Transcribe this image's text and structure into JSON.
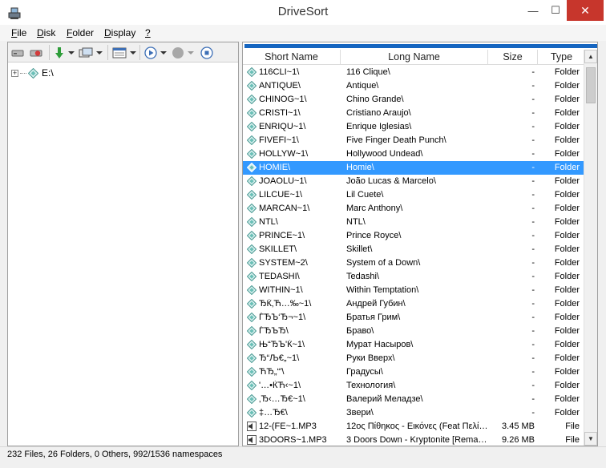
{
  "window": {
    "title": "DriveSort",
    "minimize": "—",
    "maximize": "☐",
    "close": "✕"
  },
  "menu": [
    {
      "accel": "F",
      "rest": "ile"
    },
    {
      "accel": "D",
      "rest": "isk"
    },
    {
      "accel": "F",
      "rest": "older"
    },
    {
      "accel": "D",
      "rest": "isplay"
    },
    {
      "accel": "?",
      "rest": ""
    }
  ],
  "tree": {
    "root": "E:\\",
    "expander": "+"
  },
  "progress": {
    "value": 1.0,
    "color": "#1565c0"
  },
  "columns": {
    "short": "Short Name",
    "long": "Long Name",
    "size": "Size",
    "type": "Type"
  },
  "files": [
    {
      "short": "116CLI~1\\",
      "long": "116 Clique\\",
      "size": "-",
      "type": "Folder",
      "icon": "folder-icon"
    },
    {
      "short": "ANTIQUE\\",
      "long": "Antique\\",
      "size": "-",
      "type": "Folder",
      "icon": "folder-icon"
    },
    {
      "short": "CHINOG~1\\",
      "long": "Chino Grande\\",
      "size": "-",
      "type": "Folder",
      "icon": "folder-icon"
    },
    {
      "short": "CRISTI~1\\",
      "long": "Cristiano Araujo\\",
      "size": "-",
      "type": "Folder",
      "icon": "folder-icon"
    },
    {
      "short": "ENRIQU~1\\",
      "long": "Enrique Iglesias\\",
      "size": "-",
      "type": "Folder",
      "icon": "folder-icon"
    },
    {
      "short": "FIVEFI~1\\",
      "long": "Five Finger Death Punch\\",
      "size": "-",
      "type": "Folder",
      "icon": "folder-icon"
    },
    {
      "short": "HOLLYW~1\\",
      "long": "Hollywood Undead\\",
      "size": "-",
      "type": "Folder",
      "icon": "folder-icon"
    },
    {
      "short": "HOMIE\\",
      "long": "Homie\\",
      "size": "-",
      "type": "Folder",
      "icon": "folder-icon",
      "selected": true
    },
    {
      "short": "JOAOLU~1\\",
      "long": "João Lucas & Marcelo\\",
      "size": "-",
      "type": "Folder",
      "icon": "folder-icon"
    },
    {
      "short": "LILCUE~1\\",
      "long": "Lil Cuete\\",
      "size": "-",
      "type": "Folder",
      "icon": "folder-icon"
    },
    {
      "short": "MARCAN~1\\",
      "long": "Marc Anthony\\",
      "size": "-",
      "type": "Folder",
      "icon": "folder-icon"
    },
    {
      "short": "NTL\\",
      "long": "NTL\\",
      "size": "-",
      "type": "Folder",
      "icon": "folder-icon"
    },
    {
      "short": "PRINCE~1\\",
      "long": "Prince Royce\\",
      "size": "-",
      "type": "Folder",
      "icon": "folder-icon"
    },
    {
      "short": "SKILLET\\",
      "long": "Skillet\\",
      "size": "-",
      "type": "Folder",
      "icon": "folder-icon"
    },
    {
      "short": "SYSTEM~2\\",
      "long": "System of a Down\\",
      "size": "-",
      "type": "Folder",
      "icon": "folder-icon"
    },
    {
      "short": "TEDASHI\\",
      "long": "Tedashi\\",
      "size": "-",
      "type": "Folder",
      "icon": "folder-icon"
    },
    {
      "short": "WITHIN~1\\",
      "long": "Within Temptation\\",
      "size": "-",
      "type": "Folder",
      "icon": "folder-icon"
    },
    {
      "short": "ЂЌ‚Ћ…‰~1\\",
      "long": "Андрей Губин\\",
      "size": "-",
      "type": "Folder",
      "icon": "folder-icon"
    },
    {
      "short": "ЃЂЪ‘Ђ¬~1\\",
      "long": "Братья Грим\\",
      "size": "-",
      "type": "Folder",
      "icon": "folder-icon"
    },
    {
      "short": "ЃЂЪЂ\\",
      "long": "Браво\\",
      "size": "-",
      "type": "Folder",
      "icon": "folder-icon"
    },
    {
      "short": "Њ“ЂЪ'Ќ~1\\",
      "long": "Мурат Насыров\\",
      "size": "-",
      "type": "Folder",
      "icon": "folder-icon"
    },
    {
      "short": "Ђ“Љ€„~1\\",
      "long": "Руки Вверх\\",
      "size": "-",
      "type": "Folder",
      "icon": "folder-icon"
    },
    {
      "short": "ЋЂ„“'\\",
      "long": "Градусы\\",
      "size": "-",
      "type": "Folder",
      "icon": "folder-icon"
    },
    {
      "short": "'…•ЌЋ‹~1\\",
      "long": "Технология\\",
      "size": "-",
      "type": "Folder",
      "icon": "folder-icon"
    },
    {
      "short": "‚Ђ‹…Ђ€~1\\",
      "long": "Валерий Меладзе\\",
      "size": "-",
      "type": "Folder",
      "icon": "folder-icon"
    },
    {
      "short": "‡…Ђ€\\",
      "long": "Звери\\",
      "size": "-",
      "type": "Folder",
      "icon": "folder-icon"
    },
    {
      "short": "12-(FE~1.MP3",
      "long": "12ος Πίθηκος - Εικόνες (Feat Πελί…",
      "size": "3.45 MB",
      "type": "File",
      "icon": "audio-file-icon"
    },
    {
      "short": "3DOORS~1.MP3",
      "long": "3 Doors Down - Kryptonite [Rema…",
      "size": "9.26 MB",
      "type": "File",
      "icon": "audio-file-icon"
    }
  ],
  "status": {
    "text": "232 Files, 26 Folders, 0 Others, 992/1536 namespaces"
  }
}
